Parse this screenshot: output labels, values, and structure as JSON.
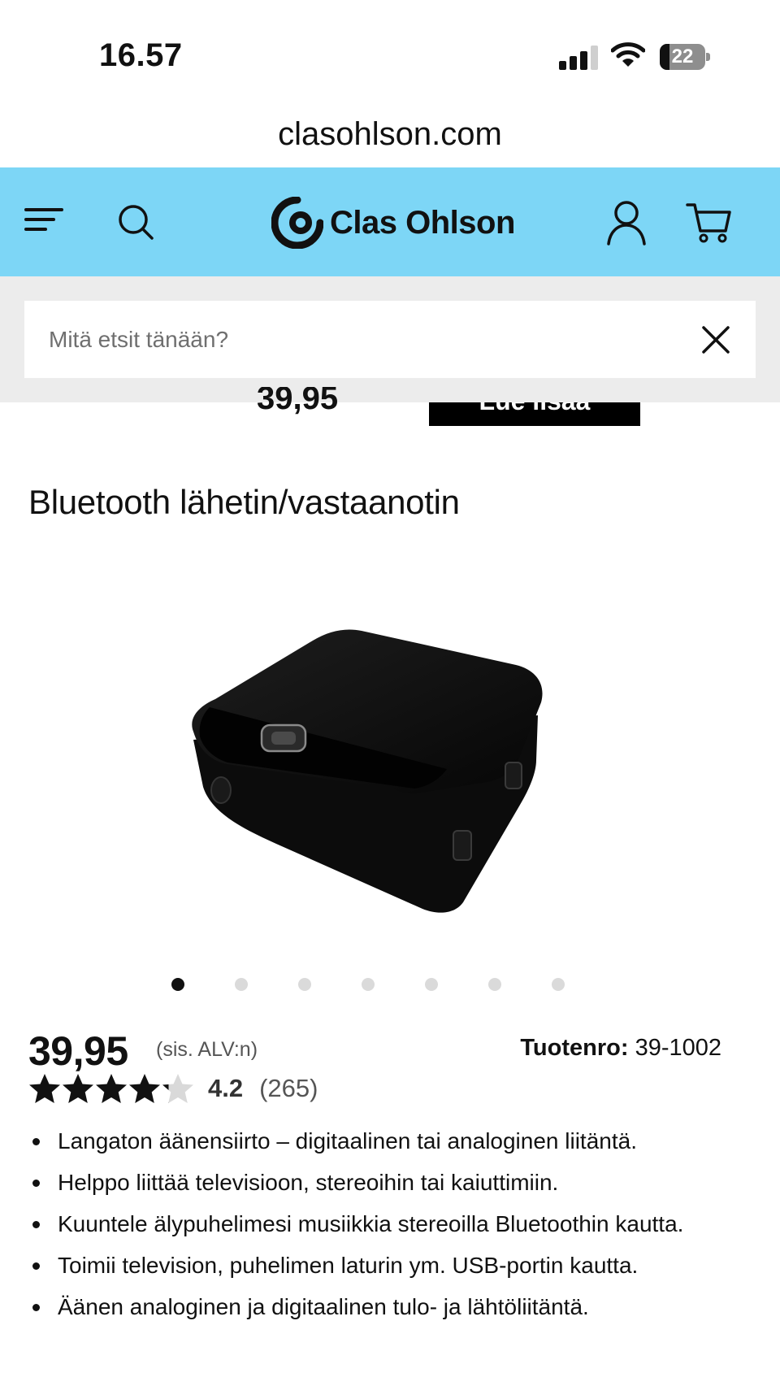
{
  "status_bar": {
    "time": "16.57",
    "battery_level": "22",
    "signal_icon": "cellular-signal-icon",
    "wifi_icon": "wifi-icon",
    "battery_icon": "battery-icon"
  },
  "browser": {
    "url": "clasohlson.com"
  },
  "header": {
    "background_color": "#7dd6f6",
    "logo_text": "Clas Ohlson",
    "icons": [
      "menu-icon",
      "search-icon",
      "clas-ohlson-logo",
      "user-icon",
      "cart-icon"
    ]
  },
  "search": {
    "placeholder": "Mitä etsit tänään?",
    "value": "",
    "close_icon": "close-icon"
  },
  "partially_hidden": {
    "price": "39,95",
    "button_label": "Lue lisää"
  },
  "product": {
    "title": "Bluetooth lähetin/vastaanotin",
    "image": "bluetooth-transmitter-receiver-image",
    "carousel": {
      "total": 7,
      "active_index": 0
    },
    "price": "39,95",
    "vat_note": "(sis. ALV:n)",
    "sku_label": "Tuotenro:",
    "sku_value": "39-1002",
    "rating": {
      "value": "4.2",
      "count": "(265)",
      "stars_filled": 4.2,
      "stars_total": 5
    },
    "features": [
      "Langaton äänensiirto – digitaalinen tai analoginen liitäntä.",
      "Helppo liittää televisioon, stereoihin tai kaiuttimiin.",
      "Kuuntele älypuhelimesi musiikkia stereoilla Bluetoothin kautta.",
      "Toimii television, puhelimen laturin ym. USB-portin kautta.",
      "Äänen analoginen ja digitaalinen tulo- ja lähtöliitäntä."
    ]
  }
}
